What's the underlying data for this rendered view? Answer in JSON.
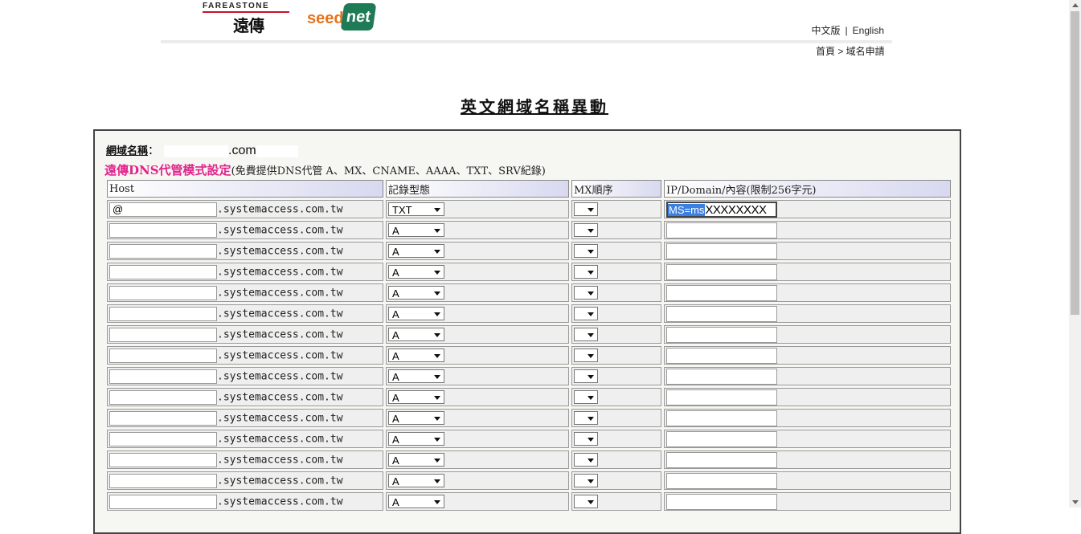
{
  "header": {
    "fet_logo_top": "FAREASTONE",
    "fet_logo_cn": "遠傳",
    "seed_logo_left": "seed",
    "seed_logo_right": "net",
    "lang_zh": "中文版",
    "lang_sep": "|",
    "lang_en": "English",
    "breadcrumb": "首頁 > 域名申請"
  },
  "page_title": "英文網域名稱異動",
  "domain": {
    "label": "網域名稱",
    "colon": "：",
    "value": ".com"
  },
  "mode": {
    "title": "遠傳DNS代管模式設定",
    "note": "(免費提供DNS代管 A、MX、CNAME、AAAA、TXT、SRV紀錄)"
  },
  "table": {
    "headers": [
      "Host",
      "記錄型態",
      "MX順序",
      "IP/Domain/內容(限制256字元)"
    ],
    "suffix": ".systemaccess.com.tw",
    "rows": [
      {
        "host": "@",
        "type": "TXT",
        "mx": "",
        "value_highlight": "MS=ms",
        "value_rest": "XXXXXXXX"
      },
      {
        "host": "",
        "type": "A",
        "mx": "",
        "value_highlight": "",
        "value_rest": ""
      },
      {
        "host": "",
        "type": "A",
        "mx": "",
        "value_highlight": "",
        "value_rest": ""
      },
      {
        "host": "",
        "type": "A",
        "mx": "",
        "value_highlight": "",
        "value_rest": ""
      },
      {
        "host": "",
        "type": "A",
        "mx": "",
        "value_highlight": "",
        "value_rest": ""
      },
      {
        "host": "",
        "type": "A",
        "mx": "",
        "value_highlight": "",
        "value_rest": ""
      },
      {
        "host": "",
        "type": "A",
        "mx": "",
        "value_highlight": "",
        "value_rest": ""
      },
      {
        "host": "",
        "type": "A",
        "mx": "",
        "value_highlight": "",
        "value_rest": ""
      },
      {
        "host": "",
        "type": "A",
        "mx": "",
        "value_highlight": "",
        "value_rest": ""
      },
      {
        "host": "",
        "type": "A",
        "mx": "",
        "value_highlight": "",
        "value_rest": ""
      },
      {
        "host": "",
        "type": "A",
        "mx": "",
        "value_highlight": "",
        "value_rest": ""
      },
      {
        "host": "",
        "type": "A",
        "mx": "",
        "value_highlight": "",
        "value_rest": ""
      },
      {
        "host": "",
        "type": "A",
        "mx": "",
        "value_highlight": "",
        "value_rest": ""
      },
      {
        "host": "",
        "type": "A",
        "mx": "",
        "value_highlight": "",
        "value_rest": ""
      },
      {
        "host": "",
        "type": "A",
        "mx": "",
        "value_highlight": "",
        "value_rest": ""
      }
    ]
  },
  "colors": {
    "mode_title": "#e0238c",
    "selection": "#3b7fe0"
  }
}
